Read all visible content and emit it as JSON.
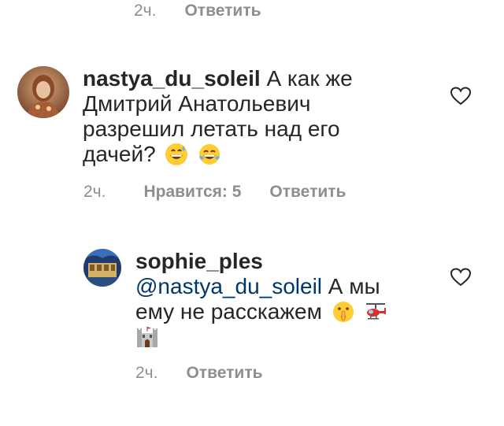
{
  "top_meta": {
    "time": "2ч.",
    "reply": "Ответить"
  },
  "comments": [
    {
      "username": "nastya_du_soleil",
      "text": "А как же Дмитрий Анатольевич разрешил летать над его дачей?",
      "emojis": [
        "grinning-sweat-emoji",
        "tears-of-joy-emoji"
      ],
      "time": "2ч.",
      "likes": "Нравится: 5",
      "reply": "Ответить"
    },
    {
      "username": "sophie_ples",
      "mention": "@nastya_du_soleil",
      "text": "А мы ему не расскажем",
      "emojis": [
        "shushing-face-emoji",
        "helicopter-emoji",
        "castle-emoji"
      ],
      "time": "2ч.",
      "reply": "Ответить"
    }
  ],
  "icons": {
    "like": "heart-outline-icon"
  },
  "colors": {
    "text": "#262626",
    "secondary": "#8e8e8e",
    "mention": "#00376b"
  }
}
